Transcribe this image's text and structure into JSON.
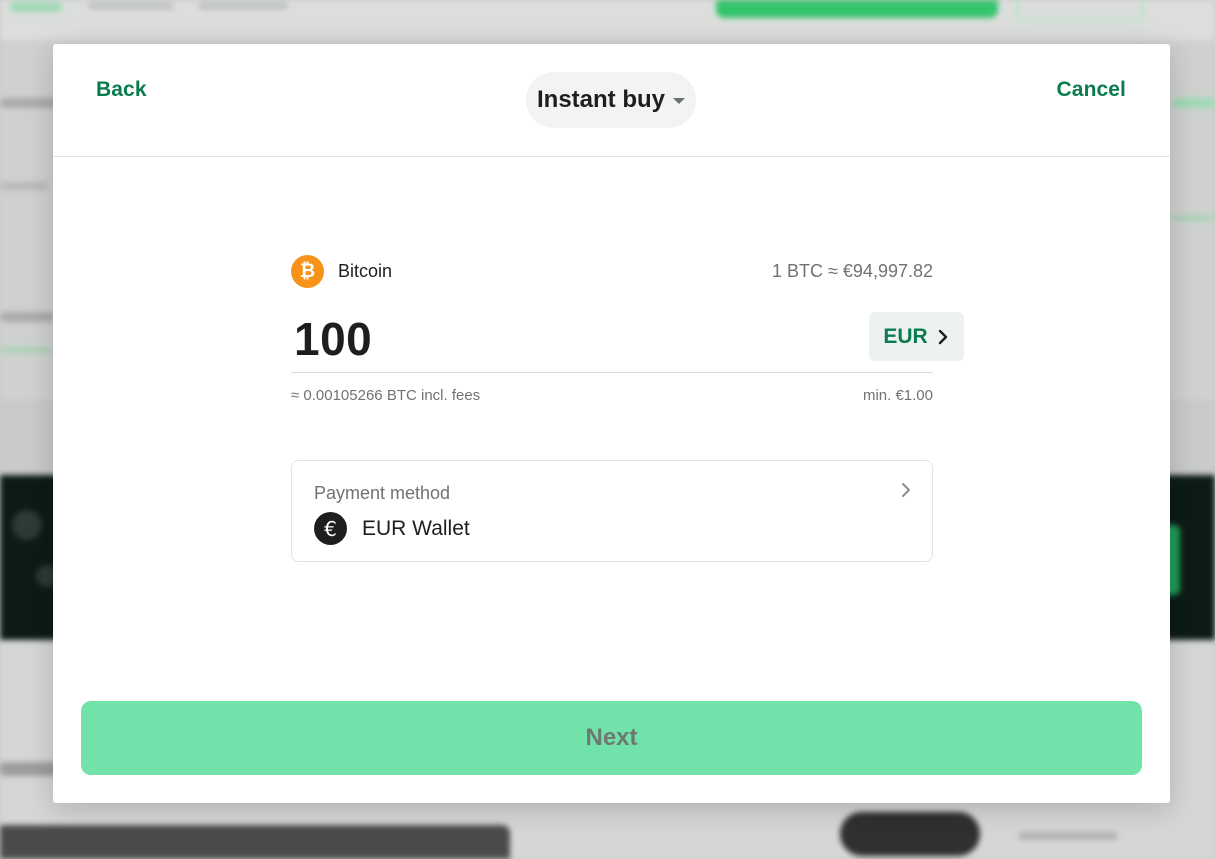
{
  "modal": {
    "back_label": "Back",
    "cancel_label": "Cancel",
    "mode": "Instant buy",
    "asset": {
      "name": "Bitcoin",
      "symbol_glyph": "₿",
      "rate": "1 BTC ≈ €94,997.82"
    },
    "amount": {
      "value": "100",
      "currency": "EUR",
      "estimate": "≈ 0.00105266 BTC incl. fees",
      "minimum": "min. €1.00"
    },
    "payment": {
      "label": "Payment method",
      "icon_glyph": "€",
      "value": "EUR Wallet"
    },
    "next_label": "Next"
  },
  "colors": {
    "accent": "#0a7d4f",
    "bitcoin": "#f7931a",
    "next_button": "#71e2a9",
    "next_text": "#6c7a72"
  },
  "icons": {
    "asset": "bitcoin-icon",
    "currency_switch": "chevron-right-icon",
    "payment_open": "chevron-right-icon",
    "payment_method": "euro-icon",
    "mode_dropdown": "chevron-down-icon"
  }
}
